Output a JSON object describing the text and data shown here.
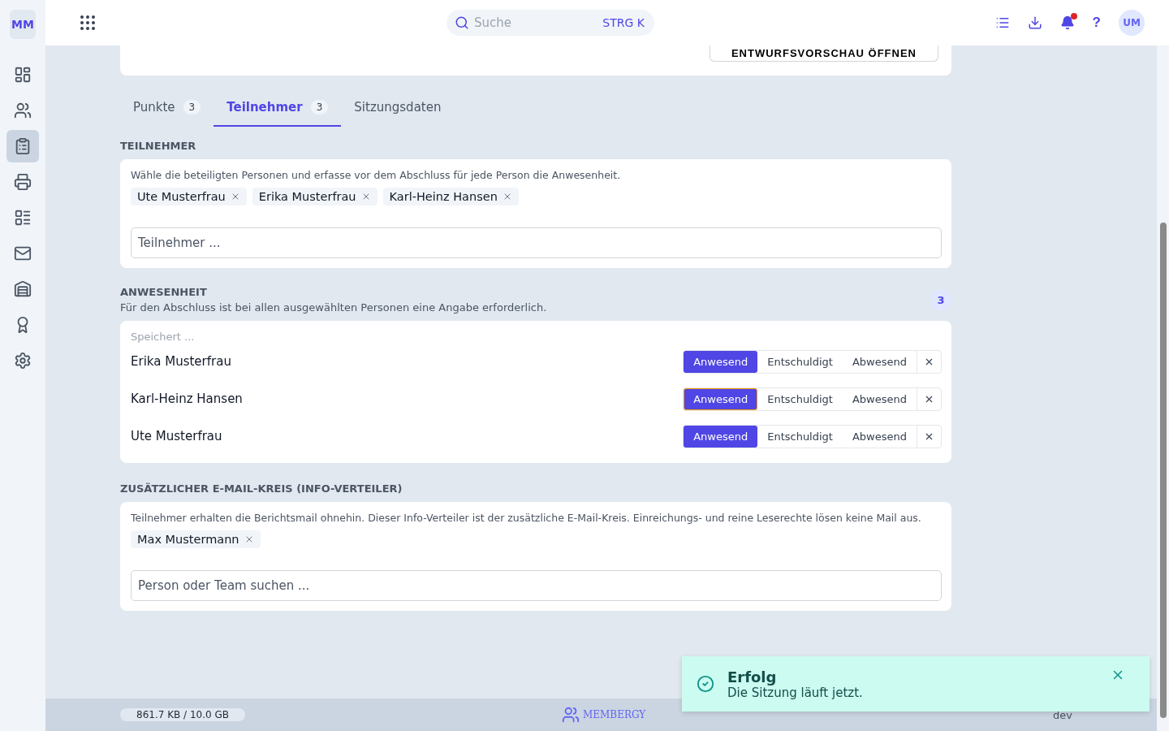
{
  "topbar": {
    "logo": "MM",
    "search": {
      "placeholder": "Suche",
      "shortcut": "STRG K"
    },
    "avatar": "UM",
    "help": "?"
  },
  "sidebar": {
    "items": [
      {
        "kind": "dashboard",
        "selected": false
      },
      {
        "kind": "people",
        "selected": false
      },
      {
        "kind": "clipboard",
        "selected": true
      },
      {
        "kind": "register",
        "selected": false
      },
      {
        "kind": "table",
        "selected": false
      },
      {
        "kind": "mail",
        "selected": false
      },
      {
        "kind": "building",
        "selected": false
      },
      {
        "kind": "award",
        "selected": false
      },
      {
        "kind": "settings",
        "selected": false
      }
    ]
  },
  "preview_button": "ENTWURFSVORSCHAU ÖFFNEN",
  "tabs": [
    {
      "label": "Punkte",
      "count": "3",
      "selected": false
    },
    {
      "label": "Teilnehmer",
      "count": "3",
      "selected": true
    },
    {
      "label": "Sitzungsdaten",
      "selected": false
    }
  ],
  "participants": {
    "heading": "TEILNEHMER",
    "hint": "Wähle die beteiligten Personen und erfasse vor dem Abschluss für jede Person die Anwesenheit.",
    "chips": [
      "Ute Musterfrau",
      "Erika Musterfrau",
      "Karl-Heinz Hansen"
    ],
    "placeholder": "Teilnehmer ..."
  },
  "attendance": {
    "heading": "ANWESENHEIT",
    "subtitle": "Für den Abschluss ist bei allen ausgewählten Personen eine Angabe erforderlich.",
    "count": "3",
    "status": "Speichert ...",
    "rows": [
      {
        "name": "Erika Musterfrau",
        "focused": false,
        "options": [
          {
            "label": "Anwesend",
            "selected": true
          },
          {
            "label": "Entschuldigt",
            "selected": false
          },
          {
            "label": "Abwesend",
            "selected": false
          }
        ]
      },
      {
        "name": "Karl-Heinz Hansen",
        "focused": true,
        "options": [
          {
            "label": "Anwesend",
            "selected": true
          },
          {
            "label": "Entschuldigt",
            "selected": false
          },
          {
            "label": "Abwesend",
            "selected": false
          }
        ]
      },
      {
        "name": "Ute Musterfrau",
        "focused": false,
        "options": [
          {
            "label": "Anwesend",
            "selected": true
          },
          {
            "label": "Entschuldigt",
            "selected": false
          },
          {
            "label": "Abwesend",
            "selected": false
          }
        ]
      }
    ]
  },
  "mail_circle": {
    "heading": "ZUSÄTZLICHER E-MAIL-KREIS (INFO-VERTEILER)",
    "hint": "Teilnehmer erhalten die Berichtsmail ohnehin. Dieser Info-Verteiler ist der zusätzliche E-Mail-Kreis. Einreichungs- und reine Leserechte lösen keine Mail aus.",
    "chips": [
      "Max Mustermann"
    ],
    "placeholder": "Person oder Team suchen ..."
  },
  "footer": {
    "storage": "861.7 KB / 10.0 GB",
    "brand": "MEMBERGY",
    "env": "dev"
  },
  "toast": {
    "title": "Erfolg",
    "message": "Die Sitzung läuft jetzt."
  }
}
